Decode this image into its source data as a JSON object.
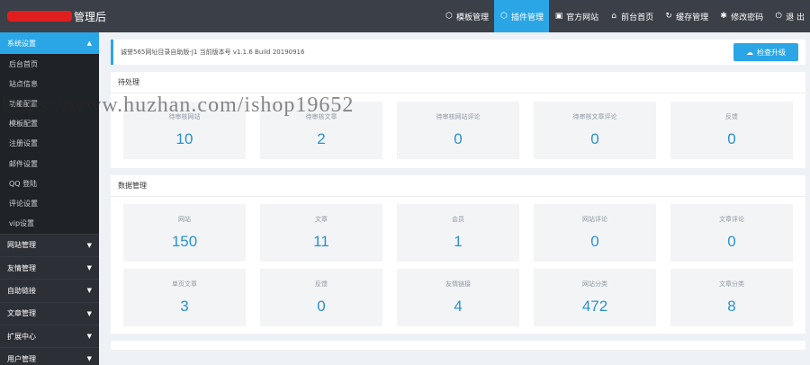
{
  "header": {
    "title": "管理后",
    "nav": [
      {
        "icon": "cube-icon",
        "glyph": "⬡",
        "label": "模板管理",
        "active": false
      },
      {
        "icon": "plugin-icon",
        "glyph": "⬡",
        "label": "插件管理",
        "active": true
      },
      {
        "icon": "website-icon",
        "glyph": "▣",
        "label": "官方网站",
        "active": false
      },
      {
        "icon": "home-icon",
        "glyph": "⌂",
        "label": "前台首页",
        "active": false
      },
      {
        "icon": "cache-icon",
        "glyph": "↻",
        "label": "缓存管理",
        "active": false
      },
      {
        "icon": "gear-icon",
        "glyph": "✱",
        "label": "修改密码",
        "active": false
      },
      {
        "icon": "power-icon",
        "glyph": "⏻",
        "label": "退 出",
        "active": false
      }
    ]
  },
  "sidebar": {
    "active_section": "系统设置",
    "sub_items": [
      "后台首页",
      "站点信息",
      "功能配置",
      "模板配置",
      "注册设置",
      "邮件设置",
      "QQ 登陆",
      "评论设置",
      "vip设置"
    ],
    "groups": [
      "网站管理",
      "友情管理",
      "自助链接",
      "文章管理",
      "扩展中心",
      "用户管理"
    ]
  },
  "notice": {
    "text": "诚誉565网址目录自助版-J1 当前版本号 v1.1.6 Build 20190916",
    "update_label": "检查升级"
  },
  "pending": {
    "title": "待处理",
    "cards": [
      {
        "label": "待审核网站",
        "value": "10"
      },
      {
        "label": "待审核文章",
        "value": "2"
      },
      {
        "label": "待审核网站评论",
        "value": "0"
      },
      {
        "label": "待审核文章评论",
        "value": "0"
      },
      {
        "label": "反馈",
        "value": "0"
      }
    ]
  },
  "stats": {
    "title": "数据管理",
    "row1": [
      {
        "label": "网站",
        "value": "150"
      },
      {
        "label": "文章",
        "value": "11"
      },
      {
        "label": "会员",
        "value": "1"
      },
      {
        "label": "网站评论",
        "value": "0"
      },
      {
        "label": "文章评论",
        "value": "0"
      }
    ],
    "row2": [
      {
        "label": "单页文章",
        "value": "3"
      },
      {
        "label": "反馈",
        "value": "0"
      },
      {
        "label": "友情链接",
        "value": "4"
      },
      {
        "label": "网站分类",
        "value": "472"
      },
      {
        "label": "文章分类",
        "value": "8"
      }
    ]
  },
  "watermark": "https://www.huzhan.com/ishop19652",
  "colors": {
    "accent": "#2aa6e6",
    "topbar": "#3b3f47",
    "sidebar": "#2c2f35",
    "value": "#2a92d0"
  }
}
